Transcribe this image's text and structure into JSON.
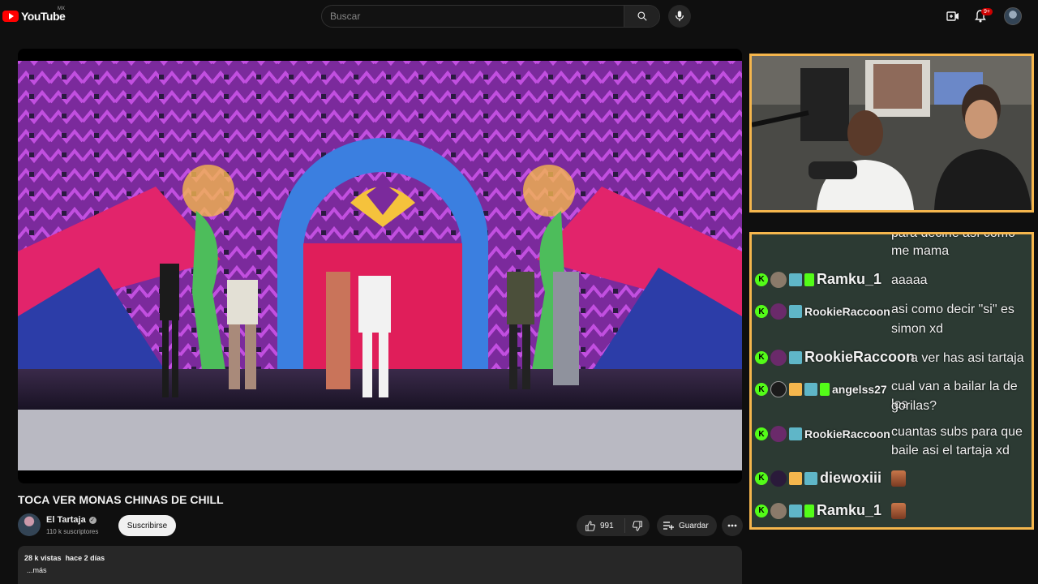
{
  "header": {
    "logo_text": "YouTube",
    "region": "MX",
    "search_placeholder": "Buscar",
    "notifications_badge": "9+"
  },
  "video": {
    "title": "TOCA VER MONAS CHINAS DE CHILL",
    "channel_name": "El Tartaja",
    "subscribers": "110 k suscriptores",
    "subscribe_label": "Suscribirse",
    "likes": "991",
    "save_label": "Guardar",
    "views": "28 k vistas",
    "date": "hace 2 días",
    "more_label": "...más"
  },
  "chat": {
    "top_partial_line1": "para decirle así como",
    "top_partial_line2": "me mama",
    "messages": [
      {
        "user": "Ramku_1",
        "text": "aaaaa"
      },
      {
        "user": "RookieRaccoon",
        "text_line1": "asi como decir \"si\" es",
        "text_line2": "simon xd"
      },
      {
        "user": "RookieRaccoon",
        "text": "a ver has asi tartaja"
      },
      {
        "user": "angelss27",
        "text_line1": "cual van a bailar la de los",
        "text_line2": "gorilas?"
      },
      {
        "user": "RookieRaccoon",
        "text_line1": "cuantas subs para que",
        "text_line2": "baile asi el tartaja xd"
      },
      {
        "user": "diewoxiii",
        "emote": "emote-icon"
      },
      {
        "user": "Ramku_1",
        "emote": "emote-icon"
      }
    ]
  },
  "colors": {
    "accent_border": "#f5b64d",
    "kick_green": "#53fc18",
    "yt_red": "#ff0000"
  }
}
